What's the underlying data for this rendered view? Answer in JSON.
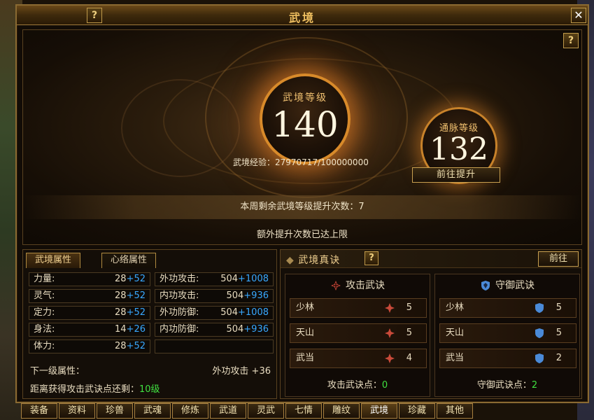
{
  "window": {
    "title": "武境",
    "help_label": "?",
    "close_label": "✕"
  },
  "stage": {
    "help_label": "?",
    "realm_level_label": "武境等级",
    "realm_level": "140",
    "meridian_level_label": "通脉等级",
    "meridian_level": "132",
    "exp_text": "武境经验：27970717/100000000",
    "goto_upgrade_label": "前往提升",
    "weekly_remaining": "本周剩余武境等级提升次数：7",
    "extra_limit": "额外提升次数已达上限"
  },
  "left_panel": {
    "tabs": [
      {
        "label": "武境属性"
      },
      {
        "label": "心络属性"
      }
    ],
    "stats_left": [
      {
        "key": "力量:",
        "base": "28",
        "bonus": "+52"
      },
      {
        "key": "灵气:",
        "base": "28",
        "bonus": "+52"
      },
      {
        "key": "定力:",
        "base": "28",
        "bonus": "+52"
      },
      {
        "key": "身法:",
        "base": "14",
        "bonus": "+26"
      },
      {
        "key": "体力:",
        "base": "28",
        "bonus": "+52"
      }
    ],
    "stats_right": [
      {
        "key": "外功攻击:",
        "base": "504",
        "bonus": "+1008"
      },
      {
        "key": "内功攻击:",
        "base": "504",
        "bonus": "+936"
      },
      {
        "key": "外功防御:",
        "base": "504",
        "bonus": "+1008"
      },
      {
        "key": "内功防御:",
        "base": "504",
        "bonus": "+936"
      }
    ],
    "next_level_label": "下一级属性：",
    "next_level_value": "外功攻击 +36",
    "distance_label": "距离获得攻击武诀点还剩：",
    "distance_value": "10级"
  },
  "right_panel": {
    "title": "武境真诀",
    "help_label": "?",
    "goto_label": "前往",
    "attack": {
      "title": "攻击武诀",
      "rows": [
        {
          "name": "少林",
          "value": "5"
        },
        {
          "name": "天山",
          "value": "5"
        },
        {
          "name": "武当",
          "value": "4"
        }
      ],
      "points_label": "攻击武诀点：",
      "points_value": "0"
    },
    "defense": {
      "title": "守御武诀",
      "rows": [
        {
          "name": "少林",
          "value": "5"
        },
        {
          "name": "天山",
          "value": "5"
        },
        {
          "name": "武当",
          "value": "2"
        }
      ],
      "points_label": "守御武诀点：",
      "points_value": "2"
    }
  },
  "bottom_tabs": [
    {
      "label": "装备"
    },
    {
      "label": "资料"
    },
    {
      "label": "珍兽"
    },
    {
      "label": "武魂"
    },
    {
      "label": "修炼"
    },
    {
      "label": "武道"
    },
    {
      "label": "灵武"
    },
    {
      "label": "七情"
    },
    {
      "label": "雕纹"
    },
    {
      "label": "武境",
      "active": true
    },
    {
      "label": "珍藏"
    },
    {
      "label": "其他"
    }
  ],
  "colors": {
    "accent_gold": "#f0c060",
    "bonus_blue": "#38a8ff",
    "highlight_green": "#40e040",
    "attack_red": "#c84a3a",
    "defense_blue": "#4a8ad8"
  }
}
